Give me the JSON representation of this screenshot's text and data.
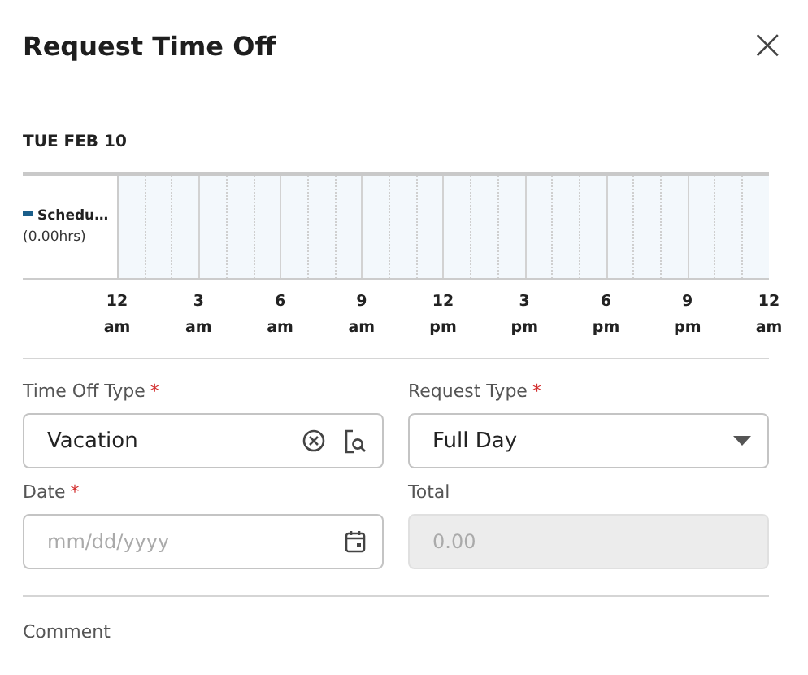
{
  "dialog": {
    "title": "Request Time Off",
    "close": "×"
  },
  "timeline": {
    "date": "TUE FEB 10",
    "legend": [
      {
        "label": "Schedu…",
        "hours": "(0.00hrs)",
        "color": "#1a5e8a"
      }
    ],
    "ticks": [
      {
        "hour": "12",
        "period": "am"
      },
      {
        "hour": "3",
        "period": "am"
      },
      {
        "hour": "6",
        "period": "am"
      },
      {
        "hour": "9",
        "period": "am"
      },
      {
        "hour": "12",
        "period": "pm"
      },
      {
        "hour": "3",
        "period": "pm"
      },
      {
        "hour": "6",
        "period": "pm"
      },
      {
        "hour": "9",
        "period": "pm"
      },
      {
        "hour": "12",
        "period": "am"
      }
    ]
  },
  "fields": [
    {
      "kind": "lookup",
      "label": "Time Off Type",
      "required_mark": "*",
      "value": "Vacation",
      "disabled": false
    },
    {
      "kind": "select",
      "label": "Request Type",
      "required_mark": "*",
      "value": "Full Day",
      "disabled": false
    },
    {
      "kind": "date",
      "label": "Date",
      "required_mark": "*",
      "placeholder": "mm/dd/yyyy",
      "disabled": false
    },
    {
      "kind": "number",
      "label": "Total",
      "placeholder": "0.00",
      "disabled": true
    }
  ],
  "comment": {
    "label": "Comment"
  }
}
